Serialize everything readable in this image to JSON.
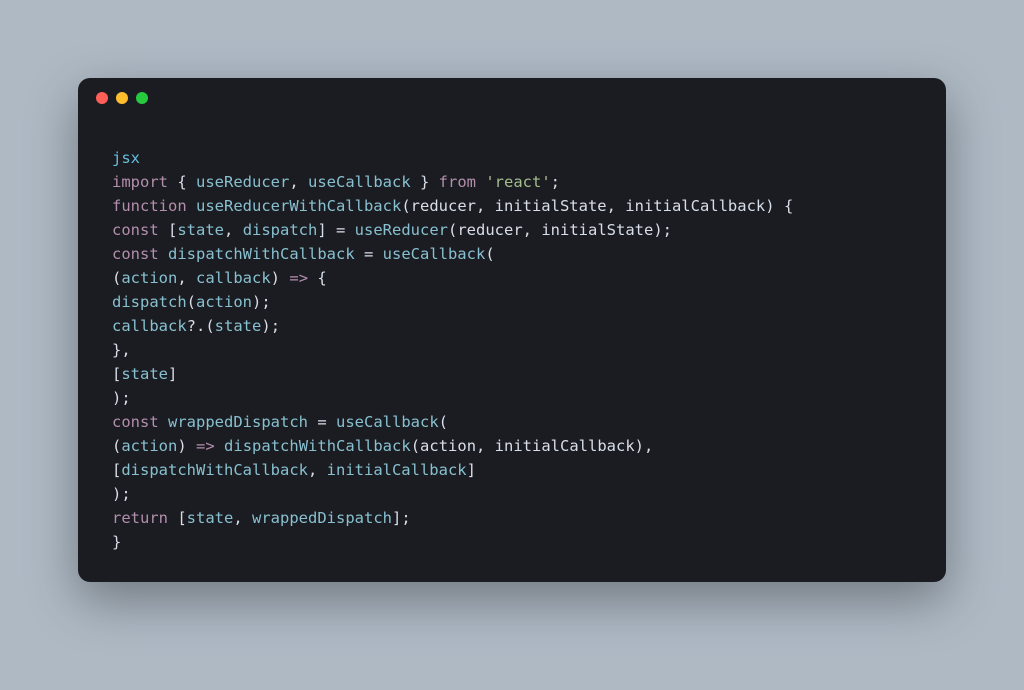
{
  "window": {
    "traffic": {
      "red": "#ff5f56",
      "yellow": "#ffbd2e",
      "green": "#27c93f"
    }
  },
  "code": {
    "lines": [
      [
        {
          "cls": "c-label",
          "t": "jsx"
        }
      ],
      [
        {
          "cls": "c-kw",
          "t": "import"
        },
        {
          "cls": "c-default",
          "t": " { "
        },
        {
          "cls": "c-ident",
          "t": "useReducer"
        },
        {
          "cls": "c-default",
          "t": ", "
        },
        {
          "cls": "c-ident",
          "t": "useCallback"
        },
        {
          "cls": "c-default",
          "t": " } "
        },
        {
          "cls": "c-kw",
          "t": "from"
        },
        {
          "cls": "c-default",
          "t": " "
        },
        {
          "cls": "c-str",
          "t": "'react'"
        },
        {
          "cls": "c-default",
          "t": ";"
        }
      ],
      [
        {
          "cls": "c-kw",
          "t": "function"
        },
        {
          "cls": "c-default",
          "t": " "
        },
        {
          "cls": "c-ident",
          "t": "useReducerWithCallback"
        },
        {
          "cls": "c-paren",
          "t": "("
        },
        {
          "cls": "c-param",
          "t": "reducer, initialState, initialCallback"
        },
        {
          "cls": "c-paren",
          "t": ")"
        },
        {
          "cls": "c-default",
          "t": " {"
        }
      ],
      [
        {
          "cls": "c-kw",
          "t": "const"
        },
        {
          "cls": "c-default",
          "t": " ["
        },
        {
          "cls": "c-ident",
          "t": "state"
        },
        {
          "cls": "c-default",
          "t": ", "
        },
        {
          "cls": "c-ident",
          "t": "dispatch"
        },
        {
          "cls": "c-default",
          "t": "] = "
        },
        {
          "cls": "c-ident",
          "t": "useReducer"
        },
        {
          "cls": "c-paren",
          "t": "("
        },
        {
          "cls": "c-param",
          "t": "reducer, initialState"
        },
        {
          "cls": "c-paren",
          "t": ")"
        },
        {
          "cls": "c-default",
          "t": ";"
        }
      ],
      [
        {
          "cls": "c-kw",
          "t": "const"
        },
        {
          "cls": "c-default",
          "t": " "
        },
        {
          "cls": "c-ident",
          "t": "dispatchWithCallback"
        },
        {
          "cls": "c-default",
          "t": " = "
        },
        {
          "cls": "c-ident",
          "t": "useCallback"
        },
        {
          "cls": "c-paren",
          "t": "("
        }
      ],
      [
        {
          "cls": "c-paren",
          "t": "("
        },
        {
          "cls": "c-ident",
          "t": "action"
        },
        {
          "cls": "c-default",
          "t": ", "
        },
        {
          "cls": "c-ident",
          "t": "callback"
        },
        {
          "cls": "c-paren",
          "t": ")"
        },
        {
          "cls": "c-default",
          "t": " "
        },
        {
          "cls": "c-arrow",
          "t": "=>"
        },
        {
          "cls": "c-default",
          "t": " {"
        }
      ],
      [
        {
          "cls": "c-ident",
          "t": "dispatch"
        },
        {
          "cls": "c-paren",
          "t": "("
        },
        {
          "cls": "c-ident",
          "t": "action"
        },
        {
          "cls": "c-paren",
          "t": ")"
        },
        {
          "cls": "c-default",
          "t": ";"
        }
      ],
      [
        {
          "cls": "c-ident",
          "t": "callback"
        },
        {
          "cls": "c-default",
          "t": "?."
        },
        {
          "cls": "c-paren",
          "t": "("
        },
        {
          "cls": "c-ident",
          "t": "state"
        },
        {
          "cls": "c-paren",
          "t": ")"
        },
        {
          "cls": "c-default",
          "t": ";"
        }
      ],
      [
        {
          "cls": "c-default",
          "t": "},"
        }
      ],
      [
        {
          "cls": "c-default",
          "t": "["
        },
        {
          "cls": "c-ident",
          "t": "state"
        },
        {
          "cls": "c-default",
          "t": "]"
        }
      ],
      [
        {
          "cls": "c-paren",
          "t": ")"
        },
        {
          "cls": "c-default",
          "t": ";"
        }
      ],
      [
        {
          "cls": "c-kw",
          "t": "const"
        },
        {
          "cls": "c-default",
          "t": " "
        },
        {
          "cls": "c-ident",
          "t": "wrappedDispatch"
        },
        {
          "cls": "c-default",
          "t": " = "
        },
        {
          "cls": "c-ident",
          "t": "useCallback"
        },
        {
          "cls": "c-paren",
          "t": "("
        }
      ],
      [
        {
          "cls": "c-paren",
          "t": "("
        },
        {
          "cls": "c-ident",
          "t": "action"
        },
        {
          "cls": "c-paren",
          "t": ")"
        },
        {
          "cls": "c-default",
          "t": " "
        },
        {
          "cls": "c-arrow",
          "t": "=>"
        },
        {
          "cls": "c-default",
          "t": " "
        },
        {
          "cls": "c-ident",
          "t": "dispatchWithCallback"
        },
        {
          "cls": "c-paren",
          "t": "("
        },
        {
          "cls": "c-param",
          "t": "action, initialCallback"
        },
        {
          "cls": "c-paren",
          "t": ")"
        },
        {
          "cls": "c-default",
          "t": ","
        }
      ],
      [
        {
          "cls": "c-default",
          "t": "["
        },
        {
          "cls": "c-ident",
          "t": "dispatchWithCallback"
        },
        {
          "cls": "c-default",
          "t": ", "
        },
        {
          "cls": "c-ident",
          "t": "initialCallback"
        },
        {
          "cls": "c-default",
          "t": "]"
        }
      ],
      [
        {
          "cls": "c-paren",
          "t": ")"
        },
        {
          "cls": "c-default",
          "t": ";"
        }
      ],
      [
        {
          "cls": "c-kw",
          "t": "return"
        },
        {
          "cls": "c-default",
          "t": " ["
        },
        {
          "cls": "c-ident",
          "t": "state"
        },
        {
          "cls": "c-default",
          "t": ", "
        },
        {
          "cls": "c-ident",
          "t": "wrappedDispatch"
        },
        {
          "cls": "c-default",
          "t": "];"
        }
      ],
      [
        {
          "cls": "c-default",
          "t": "}"
        }
      ]
    ]
  }
}
